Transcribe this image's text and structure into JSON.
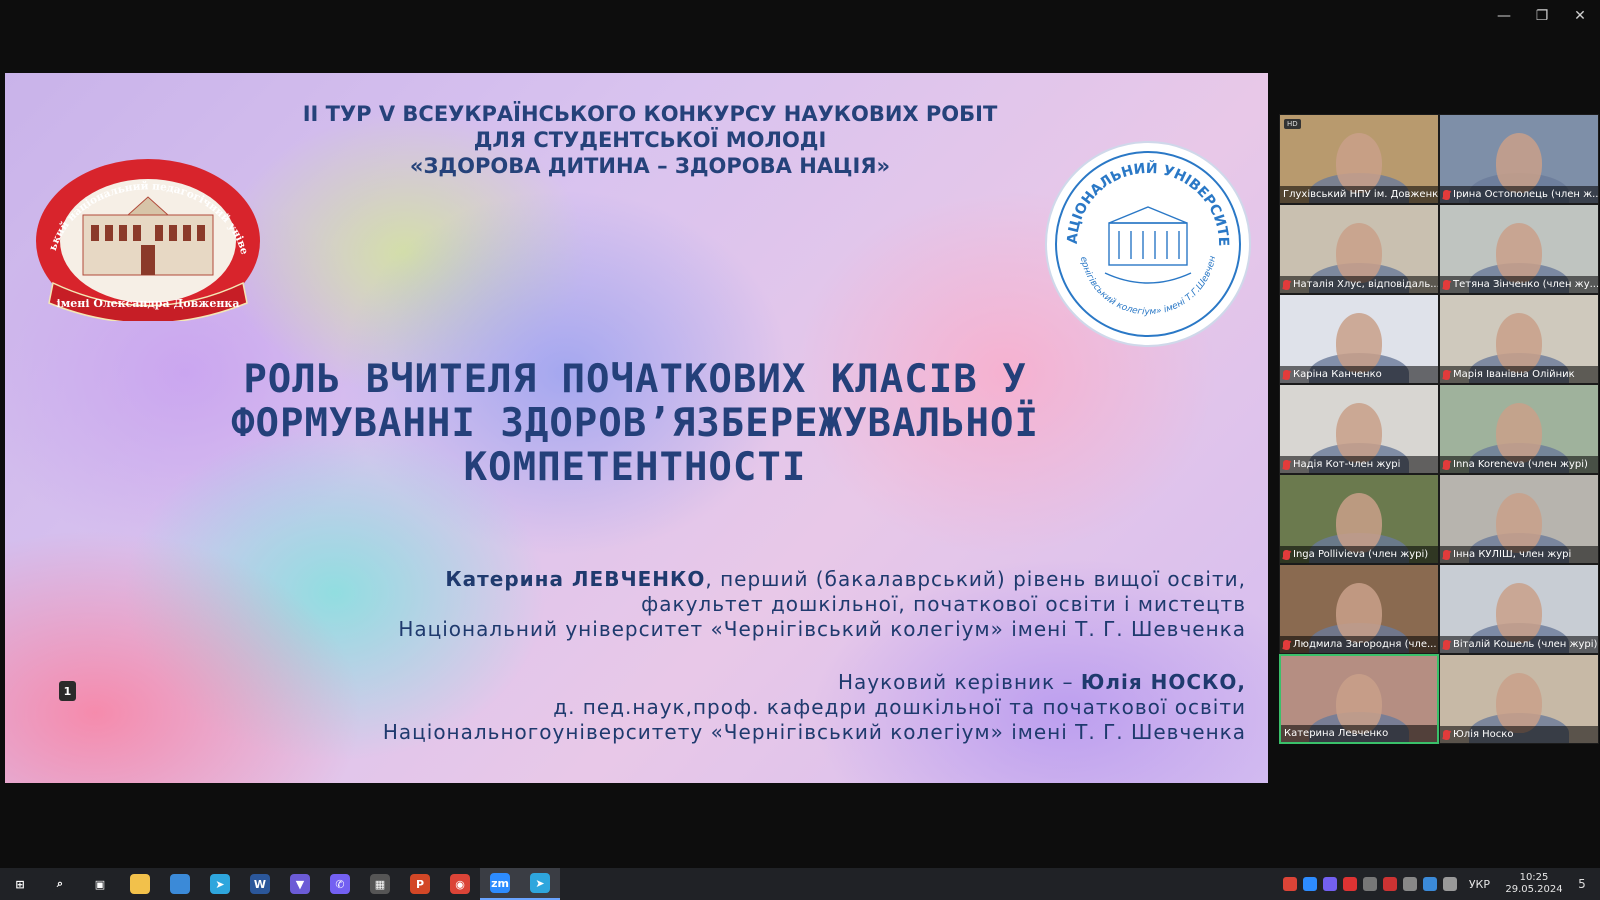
{
  "window": {
    "minimize": "—",
    "restore": "❐",
    "close": "✕"
  },
  "slide": {
    "header_lines": [
      "ІІ ТУР V ВСЕУКРАЇНСЬКОГО КОНКУРСУ НАУКОВИХ РОБІТ",
      "ДЛЯ СТУДЕНТСЬКОЇ МОЛОДІ",
      "«ЗДОРОВА ДИТИНА – ЗДОРОВА НАЦІЯ»"
    ],
    "logo_left": {
      "arc_text": "Глухівський національний педагогічний університет",
      "ribbon_text": "імені Олександра Довженка"
    },
    "logo_right": {
      "top_text": "НАЦІОНАЛЬНИЙ УНІВЕРСИТЕТ",
      "bottom_text": "«Чернігівський колегіум» імені Т.Г.Шевченка"
    },
    "title_lines": [
      "РОЛЬ ВЧИТЕЛЯ ПОЧАТКОВИХ КЛАСІВ У",
      "ФОРМУВАННІ ЗДОРОВ’ЯЗБЕРЕЖУВАЛЬНОЇ",
      "КОМПЕТЕНТНОСТІ"
    ],
    "author": {
      "name": "Катерина ЛЕВЧЕНКО",
      "line1_rest": ", перший (бакалаврський) рівень вищої освіти,",
      "line2": "факультет дошкільної, початкової освіти і мистецтв",
      "line3": "Національний університет «Чернігівський колегіум» імені Т. Г. Шевченка"
    },
    "supervisor": {
      "prefix": "Науковий керівник – ",
      "name": "Юлія НОСКО,",
      "line2": "д. пед.наук,проф. кафедри дошкільної та початкової освіти",
      "line3": "Національногоуніверситету «Чернігівський колегіум» імені Т. Г. Шевченка"
    },
    "page_number": "1"
  },
  "participants": [
    {
      "name": "Глухівський НПУ ім. Довженка",
      "muted": false,
      "bg": "#b89a6e",
      "hd": "HD"
    },
    {
      "name": "Ірина Остополець (член ж...",
      "muted": true,
      "bg": "#7e8fa8"
    },
    {
      "name": "Наталія Хлус, відповідаль...",
      "muted": true,
      "bg": "#c9c0b0"
    },
    {
      "name": "Тетяна Зінченко (член жу...",
      "muted": true,
      "bg": "#bfc4c0"
    },
    {
      "name": "Каріна Канченко",
      "muted": true,
      "bg": "#dfe2ea"
    },
    {
      "name": "Марія Іванівна Олійник",
      "muted": true,
      "bg": "#cfc9bd"
    },
    {
      "name": "Надія Кот-член журі",
      "muted": true,
      "bg": "#d8d6d2"
    },
    {
      "name": "Inna Koreneva (член журі)",
      "muted": true,
      "bg": "#9fb29c"
    },
    {
      "name": "Inga Pollivieva (член журі)",
      "muted": true,
      "bg": "#6b7a4e"
    },
    {
      "name": "Інна КУЛІШ, член журі",
      "muted": true,
      "bg": "#b7b4ae"
    },
    {
      "name": "Людмила Загородня (чле...",
      "muted": true,
      "bg": "#8a6a50"
    },
    {
      "name": "Віталій Кошель (член журі)",
      "muted": true,
      "bg": "#c8cdd4"
    },
    {
      "name": "Катерина Левченко",
      "muted": false,
      "bg": "#b58e82",
      "active": true
    },
    {
      "name": "Юлія Носко",
      "muted": true,
      "bg": "#c7b9a6"
    }
  ],
  "taskbar": {
    "apps": [
      {
        "name": "windows-start-icon",
        "color": "#202226",
        "glyph": "⊞"
      },
      {
        "name": "search-icon",
        "color": "#202226",
        "glyph": "⌕"
      },
      {
        "name": "task-view-icon",
        "color": "#202226",
        "glyph": "▣"
      },
      {
        "name": "file-explorer-icon",
        "color": "#f2c14b",
        "glyph": ""
      },
      {
        "name": "mail-icon",
        "color": "#3b8ad8",
        "glyph": ""
      },
      {
        "name": "telegram-icon",
        "color": "#2ea6dd",
        "glyph": "➤"
      },
      {
        "name": "word-icon",
        "color": "#2b579a",
        "glyph": "W"
      },
      {
        "name": "vpn-icon",
        "color": "#6b5bd6",
        "glyph": "▼"
      },
      {
        "name": "viber-icon",
        "color": "#7360f2",
        "glyph": "✆"
      },
      {
        "name": "video-editor-icon",
        "color": "#555",
        "glyph": "▦"
      },
      {
        "name": "powerpoint-icon",
        "color": "#d24726",
        "glyph": "P"
      },
      {
        "name": "chrome-icon",
        "color": "#db4437",
        "glyph": "◉"
      },
      {
        "name": "zoom-icon",
        "color": "#2d8cff",
        "glyph": "zm",
        "active": true
      },
      {
        "name": "telegram-2-icon",
        "color": "#2ea6dd",
        "glyph": "➤",
        "active": true
      }
    ],
    "language": "УКР",
    "time": "10:25",
    "date": "29.05.2024",
    "notifications": "5"
  }
}
